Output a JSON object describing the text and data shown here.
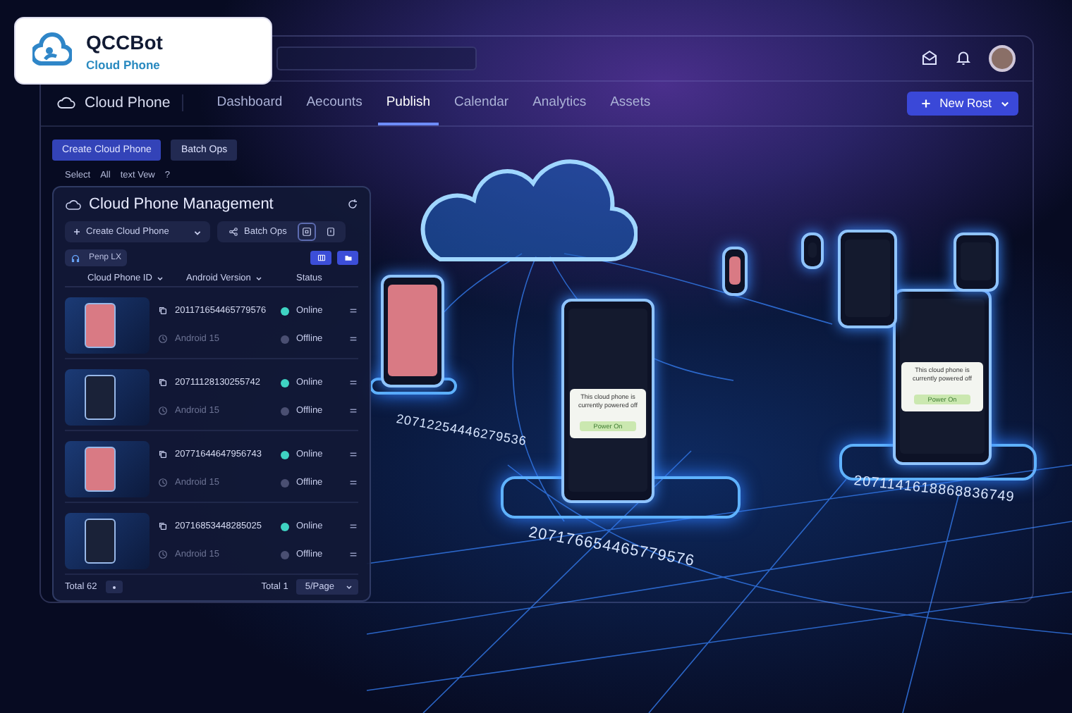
{
  "brand": {
    "name": "QCCBot",
    "subtitle": "Cloud Phone"
  },
  "nav": {
    "title": "Cloud Phone",
    "tabs": [
      {
        "label": "Dashboard",
        "selected": false
      },
      {
        "label": "Aecounts",
        "selected": false
      },
      {
        "label": "Publish",
        "selected": true
      },
      {
        "label": "Calendar",
        "selected": false
      },
      {
        "label": "Analytics",
        "selected": false
      },
      {
        "label": "Assets",
        "selected": false
      }
    ],
    "new_button": "New Rost"
  },
  "toolbar": {
    "buttons": [
      {
        "label": "Create Cloud Phone",
        "kind": "primary"
      },
      {
        "label": "Batch Ops",
        "kind": "secondary"
      }
    ],
    "select_label": "Select",
    "select_all": "All",
    "view_label": "text Vew",
    "help": "?"
  },
  "panel": {
    "title": "Cloud Phone Management",
    "create_button": "Create Cloud Phone",
    "batch_button": "Batch Ops",
    "filter_chip": "Penp LX",
    "columns": [
      {
        "label": "Cloud Phone ID",
        "sortable": true
      },
      {
        "label": "Android Version",
        "sortable": true
      },
      {
        "label": "Status",
        "sortable": false
      }
    ],
    "rows": [
      {
        "id": "201171654465779576",
        "version": "Android 15",
        "id_status": {
          "label": "Online",
          "online": true
        },
        "version_status": {
          "label": "Offline",
          "online": false
        },
        "kind": "home"
      },
      {
        "id": "20711128130255742",
        "version": "Android 15",
        "id_status": {
          "label": "Online",
          "online": true
        },
        "version_status": {
          "label": "Offline",
          "online": false
        },
        "kind": "dark"
      },
      {
        "id": "20771644647956743",
        "version": "Android 15",
        "id_status": {
          "label": "Online",
          "online": true
        },
        "version_status": {
          "label": "Offline",
          "online": false
        },
        "kind": "home"
      },
      {
        "id": "20716853448285025",
        "version": "Android 15",
        "id_status": {
          "label": "Online",
          "online": true
        },
        "version_status": {
          "label": "Offline",
          "online": false
        },
        "kind": "dark"
      }
    ],
    "footer": {
      "total": "Total 62",
      "pages": "Total 1",
      "page_size": "5/Page"
    }
  },
  "scene": {
    "labels": [
      "20712254446279536",
      "207176654465779576",
      "2071141618868836749"
    ],
    "dialogs": [
      {
        "message": "This cloud phone is currently powered off",
        "button": "Power On"
      },
      {
        "message": "This cloud phone is currently powered off",
        "button": "Power On"
      }
    ]
  }
}
